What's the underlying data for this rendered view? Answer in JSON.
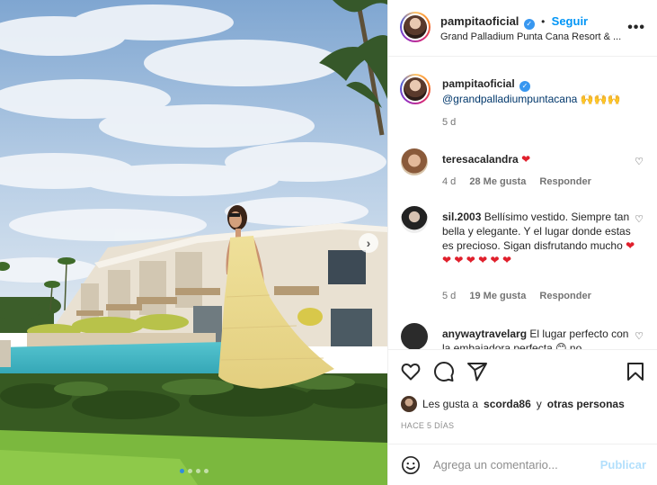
{
  "post": {
    "username": "pampitaoficial",
    "verified_glyph": "✓",
    "follow_dot": "•",
    "follow_label": "Seguir",
    "location": "Grand Palladium Punta Cana Resort & ...",
    "more_icon": "more-horizontal-icon"
  },
  "caption": {
    "username": "pampitaoficial",
    "text": "@grandpalladiumpuntacana",
    "emojis": "🙌🙌🙌",
    "time": "5 d"
  },
  "comments": [
    {
      "username": "teresacalandra",
      "text": "",
      "hearts": "❤",
      "time": "4 d",
      "likes": "28 Me gusta",
      "reply": "Responder"
    },
    {
      "username": "sil.2003",
      "text": "Bellísimo vestido. Siempre tan bella y elegante. Y el lugar donde estas es precioso. Sigan disfrutando mucho",
      "hearts": "❤ ❤ ❤ ❤ ❤ ❤ ❤",
      "time": "5 d",
      "likes": "19 Me gusta",
      "reply": "Responder"
    },
    {
      "username": "anywaytravelarg",
      "text": "El lugar perfecto con la embajadora perfecta 😊 no",
      "hearts": "",
      "time": "",
      "likes": "",
      "reply": ""
    }
  ],
  "actions": {
    "like_icon": "heart-icon",
    "comment_icon": "comment-icon",
    "share_icon": "send-icon",
    "save_icon": "bookmark-icon"
  },
  "likes": {
    "prefix": "Les gusta a",
    "user": "scorda86",
    "middle": "y",
    "others": "otras personas"
  },
  "time_ago": "HACE 5 DÍAS",
  "add_comment": {
    "placeholder": "Agrega un comentario...",
    "publish": "Publicar"
  },
  "carousel": {
    "next_glyph": "›",
    "slides": 4,
    "active_slide": 1
  },
  "colors": {
    "accent": "#0095f6",
    "heart": "#e0202c",
    "verified": "#3897f0"
  }
}
